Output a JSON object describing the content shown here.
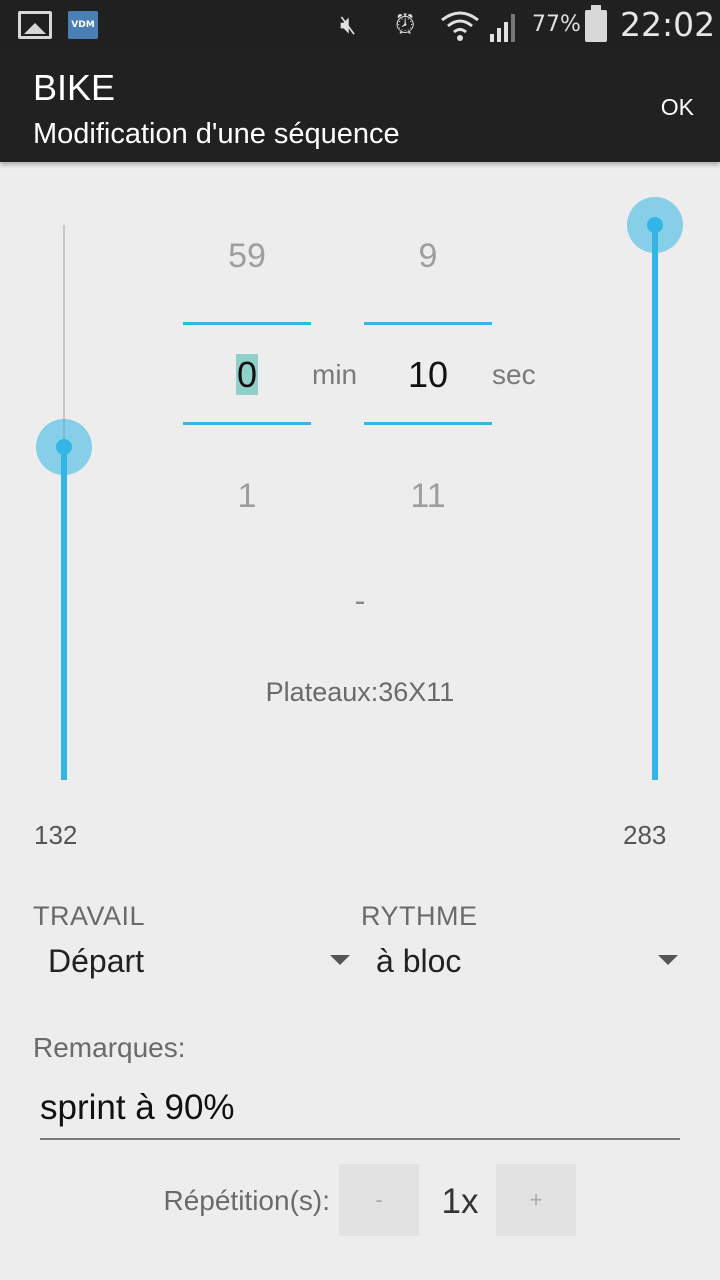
{
  "status_bar": {
    "battery": "77%",
    "time": "22:02",
    "icons": [
      "image-icon",
      "vdm-icon",
      "mute-icon",
      "alarm-icon",
      "wifi-icon",
      "signal-icon",
      "battery-icon"
    ],
    "vdm_label": "VDM"
  },
  "action_bar": {
    "title": "BIKE",
    "subtitle": "Modification d'une séquence",
    "ok_label": "OK"
  },
  "left_slider": {
    "value_label": "132",
    "level": 0.6,
    "accent": "#33b5e5"
  },
  "right_slider": {
    "value_label": "283",
    "level": 1.0,
    "accent": "#33b5e5"
  },
  "time_picker": {
    "minutes": {
      "prev": "59",
      "current": "0",
      "next": "1",
      "unit": "min"
    },
    "seconds": {
      "prev": "9",
      "current": "10",
      "next": "11",
      "unit": "sec"
    }
  },
  "dash": "-",
  "plateaux": "Plateaux:36X11",
  "travail": {
    "label": "TRAVAIL",
    "value": "Départ"
  },
  "rythme": {
    "label": "RYTHME",
    "value": "à bloc"
  },
  "remarks": {
    "label": "Remarques:",
    "value": "sprint à 90%"
  },
  "repetitions": {
    "label": "Répétition(s):",
    "minus": "-",
    "count": "1x",
    "plus": "+"
  }
}
